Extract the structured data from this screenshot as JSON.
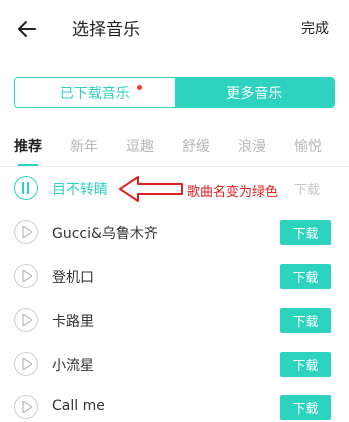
{
  "header": {
    "title": "选择音乐",
    "done_label": "完成"
  },
  "segments": [
    {
      "label": "已下载音乐"
    },
    {
      "label": "更多音乐"
    }
  ],
  "tabs": [
    {
      "label": "推荐"
    },
    {
      "label": "新年"
    },
    {
      "label": "逗趣"
    },
    {
      "label": "舒缓"
    },
    {
      "label": "浪漫"
    },
    {
      "label": "愉悦"
    }
  ],
  "songs": [
    {
      "name": "目不转睛",
      "download_label": "下载"
    },
    {
      "name": "Gucci&乌鲁木齐",
      "download_label": "下载"
    },
    {
      "name": "登机口",
      "download_label": "下载"
    },
    {
      "name": "卡路里",
      "download_label": "下载"
    },
    {
      "name": "小流星",
      "download_label": "下载"
    },
    {
      "name": "Call me",
      "download_label": "下载"
    }
  ],
  "annotation": {
    "text": "歌曲名变为绿色"
  },
  "colors": {
    "accent": "#2ed3c0",
    "annotation": "#e02020",
    "badge_dot": "#ff3b30"
  }
}
